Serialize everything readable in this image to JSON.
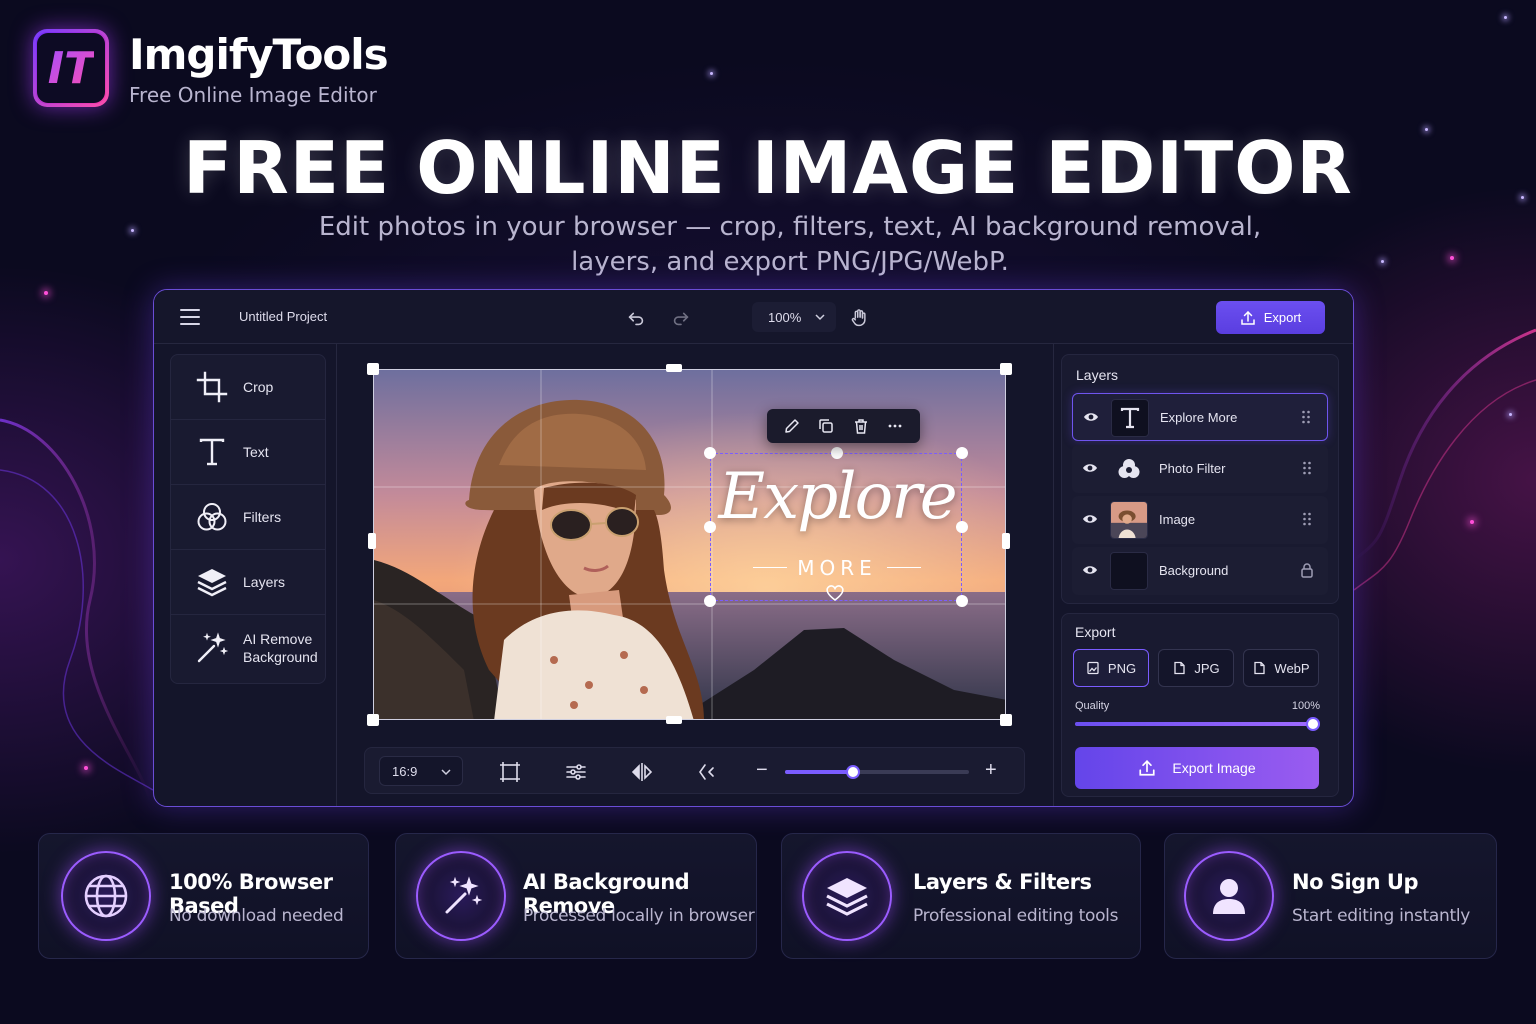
{
  "brand": {
    "logo_text": "IT",
    "name": "ImgifyTools",
    "tagline": "Free Online Image Editor"
  },
  "hero": {
    "title": "FREE ONLINE IMAGE EDITOR",
    "subtitle_line1": "Edit photos in your browser — crop, filters, text, AI background removal,",
    "subtitle_line2": "layers, and export PNG/JPG/WebP."
  },
  "topbar": {
    "project_name": "Untitled Project",
    "zoom": "100%",
    "export_label": "Export"
  },
  "tools": [
    {
      "label": "Crop",
      "icon": "crop-icon"
    },
    {
      "label": "Text",
      "icon": "text-icon"
    },
    {
      "label": "Filters",
      "icon": "filters-icon"
    },
    {
      "label": "Layers",
      "icon": "layers-icon"
    },
    {
      "label_line1": "AI Remove",
      "label_line2": "Background",
      "icon": "magic-wand-icon"
    }
  ],
  "canvas": {
    "text_main": "Explore",
    "text_sub": "MORE",
    "aspect_ratio": "16:9",
    "zoom_slider": 0.37,
    "minus": "−",
    "plus": "+"
  },
  "layers": {
    "title": "Layers",
    "items": [
      {
        "label": "Explore More",
        "active": true
      },
      {
        "label": "Photo Filter"
      },
      {
        "label": "Image"
      },
      {
        "label": "Background",
        "locked": true
      }
    ]
  },
  "export": {
    "title": "Export",
    "formats": [
      {
        "label": "PNG",
        "active": true
      },
      {
        "label": "JPG"
      },
      {
        "label": "WebP"
      }
    ],
    "quality_label": "Quality",
    "quality_value": "100%",
    "quality": 1.0,
    "button_label": "Export Image"
  },
  "features": [
    {
      "title": "100% Browser Based",
      "subtitle": "No download needed",
      "icon": "globe-icon"
    },
    {
      "title": "AI Background Remove",
      "subtitle": "Processed locally in browser",
      "icon": "magic-wand-icon"
    },
    {
      "title": "Layers & Filters",
      "subtitle": "Professional editing tools",
      "icon": "layers-icon"
    },
    {
      "title": "No Sign Up",
      "subtitle": "Start editing instantly",
      "icon": "user-icon"
    }
  ],
  "colors": {
    "background": "#0b0a1f",
    "accent": "#6b4ff0",
    "accent_glow": "#9b5cff",
    "brand_gradient_start": "#6b2cff",
    "brand_gradient_end": "#ff3fa4"
  }
}
